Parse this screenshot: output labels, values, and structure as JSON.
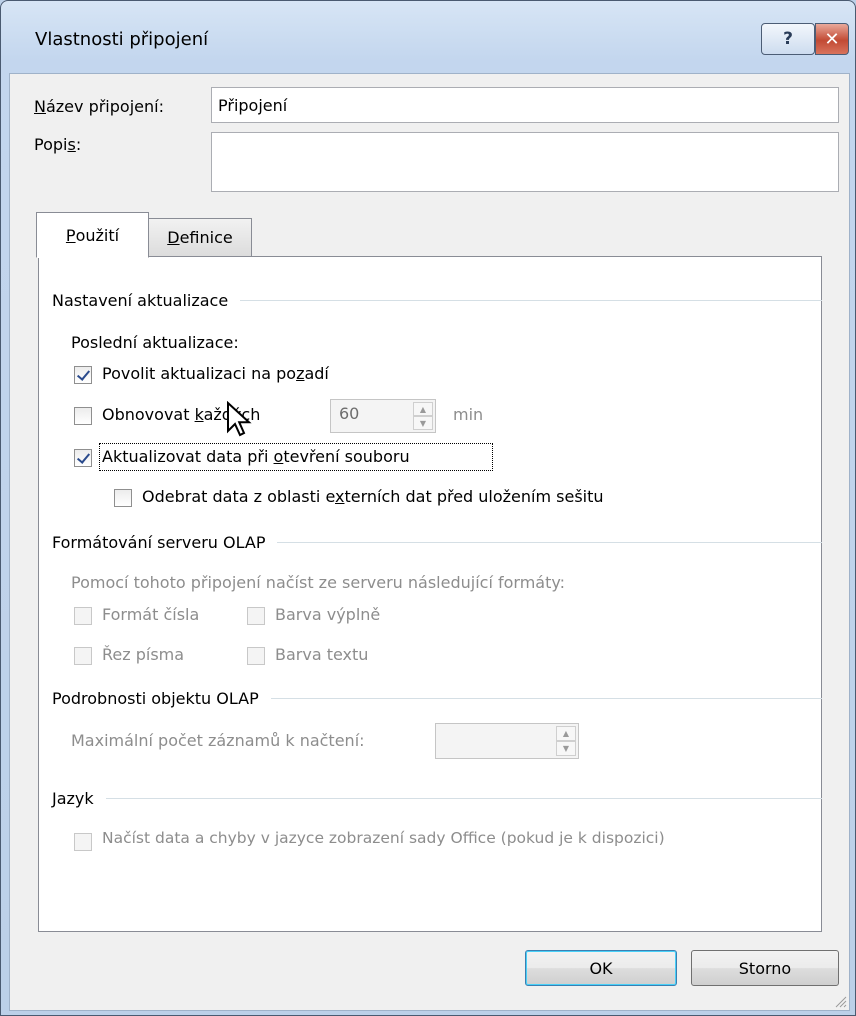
{
  "window": {
    "title": "Vlastnosti připojení",
    "help_glyph": "?",
    "close_glyph": "✕"
  },
  "connection": {
    "name_label_mnemonic": "N",
    "name_label_rest": "ázev připojení:",
    "name_value": "Připojení",
    "desc_label_pre": "Popi",
    "desc_label_mnemonic": "s",
    "desc_label_post": ":",
    "desc_value": ""
  },
  "tabs": [
    {
      "mnemonic": "P",
      "rest": "oužití"
    },
    {
      "mnemonic": "D",
      "rest": "efinice"
    }
  ],
  "refresh": {
    "group_title": "Nastavení aktualizace",
    "last_refresh": "Poslední aktualizace:",
    "background_pre": "Povolit aktualizaci na po",
    "background_mn": "z",
    "background_post": "adí",
    "background_checked": true,
    "every_pre": "Obnovovat ",
    "every_mn": "k",
    "every_post": "aždých",
    "every_checked": false,
    "every_value": "60",
    "every_unit": "min",
    "onopen_pre": "Aktualizovat data při ",
    "onopen_mn": "o",
    "onopen_post": "tevření souboru",
    "onopen_checked": true,
    "remove_pre": "Odebrat data z oblasti e",
    "remove_mn": "x",
    "remove_post": "terních dat před uložením sešitu",
    "remove_checked": false
  },
  "olap_format": {
    "group_title": "Formátování serveru OLAP",
    "desc": "Pomocí tohoto připojení načíst ze serveru následující formáty:",
    "number_format": "Formát čísla",
    "fill_color": "Barva výplně",
    "font_style": "Řez písma",
    "text_color": "Barva textu"
  },
  "olap_drill": {
    "group_title": "Podrobnosti objektu OLAP",
    "max_records": "Maximální počet záznamů k načtení:",
    "max_value": ""
  },
  "language": {
    "group_title": "Jazyk",
    "option": "Načíst data a chyby v jazyce zobrazení sady Office (pokud je k dispozici)"
  },
  "buttons": {
    "ok": "OK",
    "cancel": "Storno"
  }
}
